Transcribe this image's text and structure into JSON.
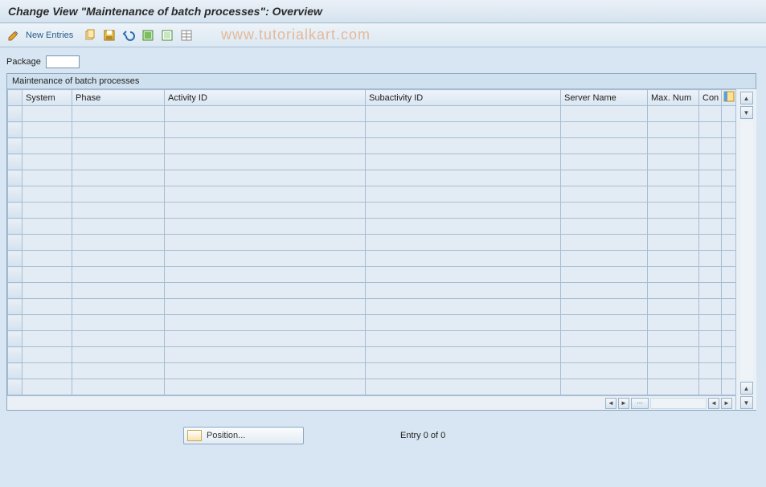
{
  "title": "Change View \"Maintenance of batch processes\": Overview",
  "toolbar": {
    "new_entries_label": "New Entries"
  },
  "watermark": "www.tutorialkart.com",
  "field": {
    "package_label": "Package",
    "package_value": ""
  },
  "panel": {
    "title": "Maintenance of batch processes",
    "columns": {
      "system": "System",
      "phase": "Phase",
      "activity": "Activity ID",
      "subactivity": "Subactivity ID",
      "server": "Server Name",
      "maxnum": "Max. Num",
      "con": "Con"
    }
  },
  "footer": {
    "position_label": "Position...",
    "entry_status": "Entry 0 of 0"
  }
}
